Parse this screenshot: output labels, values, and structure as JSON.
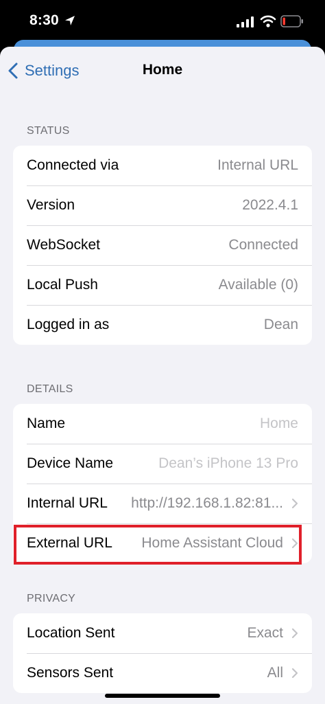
{
  "status_bar": {
    "time": "8:30",
    "icons": [
      "location-arrow-icon",
      "cellular-signal-icon",
      "wifi-icon",
      "battery-low-icon"
    ],
    "battery_color": "#ff3b30"
  },
  "nav": {
    "back_label": "Settings",
    "title": "Home",
    "accent": "#2f6eb4"
  },
  "status": {
    "header": "STATUS",
    "rows": [
      {
        "label": "Connected via",
        "value": "Internal URL"
      },
      {
        "label": "Version",
        "value": "2022.4.1"
      },
      {
        "label": "WebSocket",
        "value": "Connected"
      },
      {
        "label": "Local Push",
        "value": "Available (0)"
      },
      {
        "label": "Logged in as",
        "value": "Dean"
      }
    ]
  },
  "details": {
    "header": "DETAILS",
    "name": {
      "label": "Name",
      "placeholder": "Home"
    },
    "device_name": {
      "label": "Device Name",
      "placeholder": "Dean’s iPhone 13 Pro"
    },
    "internal_url": {
      "label": "Internal URL",
      "value": "http://192.168.1.82:81..."
    },
    "external_url": {
      "label": "External URL",
      "value": "Home Assistant Cloud"
    },
    "highlight_color": "#e0202a"
  },
  "privacy": {
    "header": "PRIVACY",
    "rows": [
      {
        "label": "Location Sent",
        "value": "Exact"
      },
      {
        "label": "Sensors Sent",
        "value": "All"
      }
    ]
  }
}
